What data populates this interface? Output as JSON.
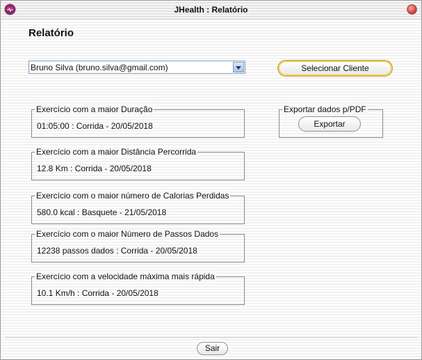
{
  "window": {
    "title": "JHealth : Relatório"
  },
  "page": {
    "heading": "Relatório"
  },
  "client_select": {
    "selected": "Bruno Silva (bruno.silva@gmail.com)"
  },
  "buttons": {
    "select_client": "Selecionar Cliente",
    "export": "Exportar",
    "exit": "Sair"
  },
  "export_group": {
    "title": "Exportar dados p/PDF"
  },
  "records": [
    {
      "title": "Exercício com a maior Duração",
      "value": "01:05:00 : Corrida - 20/05/2018"
    },
    {
      "title": "Exercício com a maior Distância Percorrida",
      "value": "12.8 Km : Corrida - 20/05/2018"
    },
    {
      "title": "Exercício com o maior número de Calorias Perdidas",
      "value": "580.0 kcal : Basquete - 21/05/2018"
    },
    {
      "title": "Exercício com o maior Número de Passos Dados",
      "value": "12238 passos dados : Corrida - 20/05/2018"
    },
    {
      "title": "Exercício com a velocidade máxima mais rápida",
      "value": "10.1 Km/h : Corrida - 20/05/2018"
    }
  ],
  "icons": {
    "app": "heart-pulse-icon",
    "close": "close-icon",
    "dropdown": "chevron-down-icon"
  },
  "colors": {
    "close_button": "#d9534f",
    "focus_ring": "#f1cc4b",
    "app_icon": "#c2185b"
  }
}
